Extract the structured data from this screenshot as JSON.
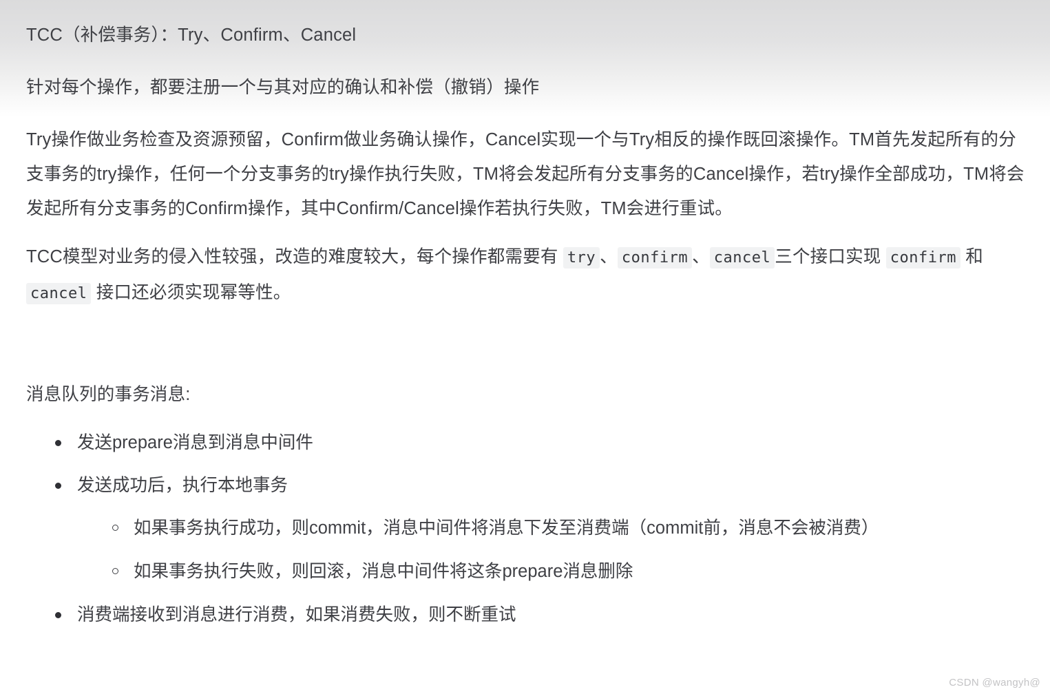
{
  "page": {
    "background_color": "#ffffff",
    "gradient_top_color": "#dbdbdc",
    "text_color": "#3f4045",
    "code_background_color": "#f1f2f3"
  },
  "content": {
    "heading": "TCC（补偿事务）：Try、Confirm、Cancel",
    "intro": "针对每个操作，都要注册一个与其对应的确认和补偿（撤销）操作",
    "paragraph_flow": "Try操作做业务检查及资源预留，Confirm做业务确认操作，Cancel实现一个与Try相反的操作既回滚操作。TM首先发起所有的分支事务的try操作，任何一个分支事务的try操作执行失败，TM将会发起所有分支事务的Cancel操作，若try操作全部成功，TM将会发起所有分支事务的Confirm操作，其中Confirm/Cancel操作若执行失败，TM会进行重试。",
    "paragraph_tcc_model": {
      "part1": "TCC模型对业务的侵入性较强，改造的难度较大，每个操作都需要有 ",
      "code_try": "try",
      "sep1": "、",
      "code_confirm": "confirm",
      "sep2": "、",
      "code_cancel": "cancel",
      "part2": "三个接口实现 ",
      "code_confirm_2": "confirm",
      "part3": " 和 ",
      "code_cancel_2": "cancel",
      "part4": " 接口还必须实现幂等性。"
    },
    "section_mq_title": "消息队列的事务消息:",
    "mq_list": [
      {
        "text": "发送prepare消息到消息中间件",
        "children": []
      },
      {
        "text": "发送成功后，执行本地事务",
        "children": [
          "如果事务执行成功，则commit，消息中间件将消息下发至消费端（commit前，消息不会被消费）",
          "如果事务执行失败，则回滚，消息中间件将这条prepare消息删除"
        ]
      },
      {
        "text": "消费端接收到消息进行消费，如果消费失败，则不断重试",
        "children": []
      }
    ]
  },
  "watermark": {
    "text": "CSDN @wangyh@"
  }
}
